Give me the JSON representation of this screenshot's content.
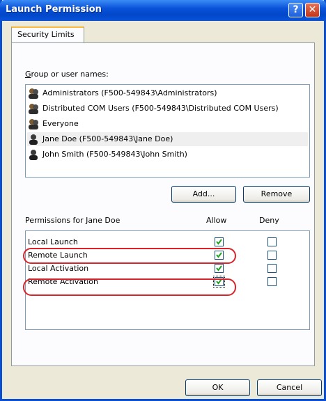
{
  "window": {
    "title": "Launch Permission"
  },
  "tabs": [
    {
      "label": "Security Limits"
    }
  ],
  "group_label": "Group or user names:",
  "users": [
    {
      "name": "Administrators (F500-549843\\Administrators)",
      "icon": "group-icon"
    },
    {
      "name": "Distributed COM Users (F500-549843\\Distributed COM Users)",
      "icon": "group-icon"
    },
    {
      "name": "Everyone",
      "icon": "group-icon"
    },
    {
      "name": "Jane Doe (F500-549843\\Jane Doe)",
      "icon": "user-icon",
      "selected": true
    },
    {
      "name": "John Smith (F500-549843\\John Smith)",
      "icon": "user-icon"
    }
  ],
  "buttons": {
    "add": "Add...",
    "remove": "Remove",
    "ok": "OK",
    "cancel": "Cancel"
  },
  "permissions": {
    "header": "Permissions for Jane Doe",
    "allow_header": "Allow",
    "deny_header": "Deny",
    "rows": [
      {
        "label": "Local Launch",
        "allow": true,
        "deny": false
      },
      {
        "label": "Remote Launch",
        "allow": true,
        "deny": false
      },
      {
        "label": "Local Activation",
        "allow": true,
        "deny": false
      },
      {
        "label": "Remote Activation",
        "allow": true,
        "deny": false
      }
    ]
  },
  "colors": {
    "highlight": "#d9232a",
    "titlebar": "#0a52d9",
    "check": "#21a121"
  }
}
